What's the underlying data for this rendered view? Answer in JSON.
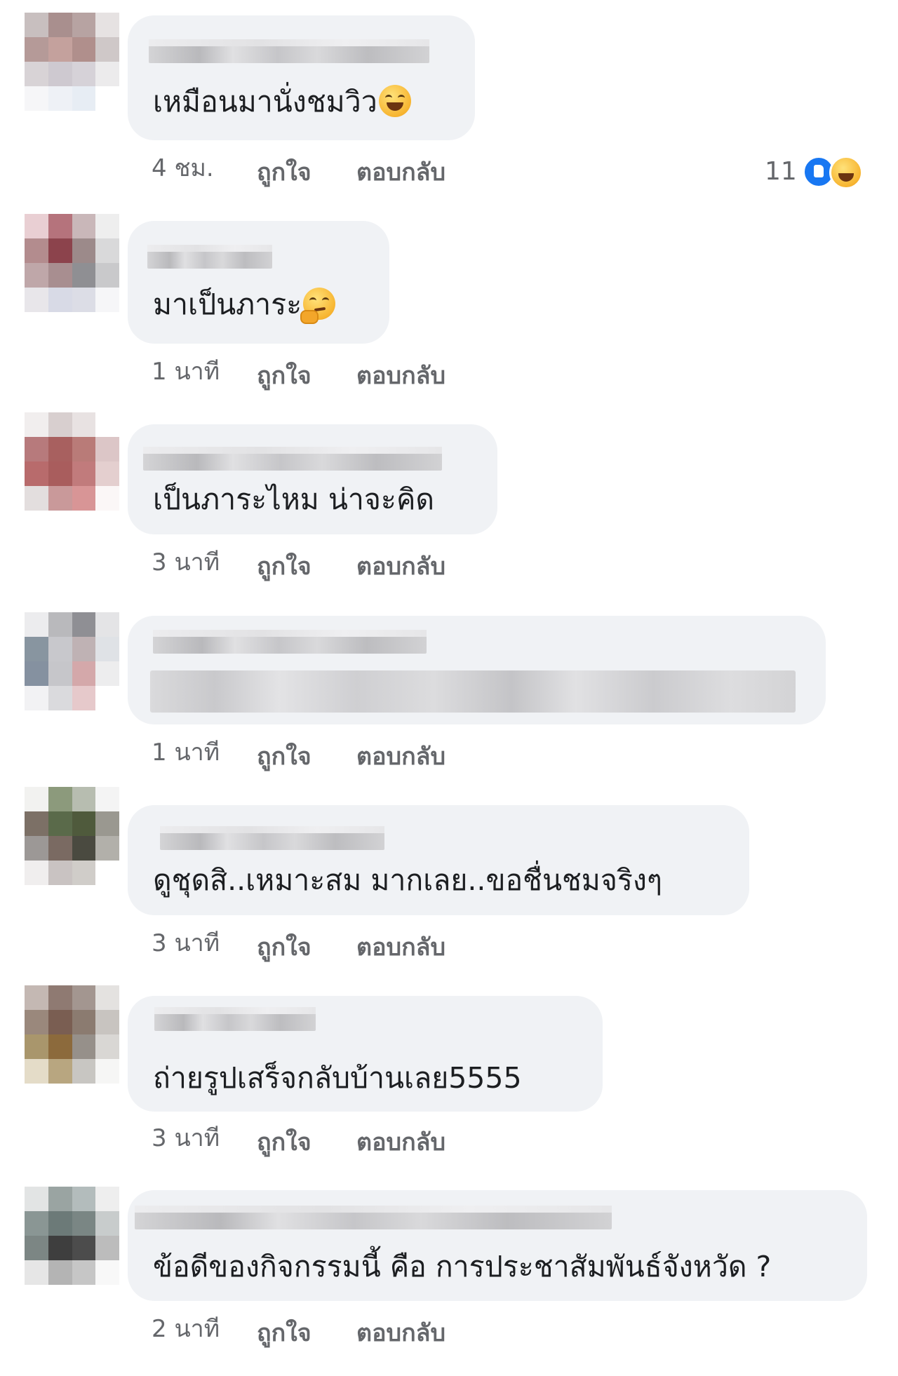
{
  "comments": [
    {
      "text": "เหมือนมานั่งชมวิว",
      "emoji": "laughing-emoji",
      "time": "4 ชม.",
      "like": "ถูกใจ",
      "reply": "ตอบกลับ",
      "reaction_count": "11",
      "reactions": [
        "like-reaction-icon",
        "haha-reaction-icon"
      ]
    },
    {
      "text": "มาเป็นภาระ",
      "emoji": "thinking-emoji",
      "time": "1 นาที",
      "like": "ถูกใจ",
      "reply": "ตอบกลับ"
    },
    {
      "text": "เป็นภาระไหม  น่าจะคิด",
      "time": "3 นาที",
      "like": "ถูกใจ",
      "reply": "ตอบกลับ"
    },
    {
      "text": "",
      "time": "1 นาที",
      "like": "ถูกใจ",
      "reply": "ตอบกลับ"
    },
    {
      "text": "ดูชุดสิ..เหมาะสม มากเลย..ขอชื่นชมจริงๆ",
      "time": "3 นาที",
      "like": "ถูกใจ",
      "reply": "ตอบกลับ"
    },
    {
      "text": "ถ่ายรูปเสร็จกลับบ้านเลย5555",
      "time": "3 นาที",
      "like": "ถูกใจ",
      "reply": "ตอบกลับ"
    },
    {
      "text": "ข้อดีของกิจกรรมนี้ คือ การประชาสัมพันธ์จังหวัด ?",
      "time": "2 นาที",
      "like": "ถูกใจ",
      "reply": "ตอบกลับ"
    }
  ],
  "colors": {
    "bubble": "#f0f2f5",
    "meta_text": "#65676b",
    "body_text": "#1c1e21",
    "like_blue": "#1877f2"
  }
}
